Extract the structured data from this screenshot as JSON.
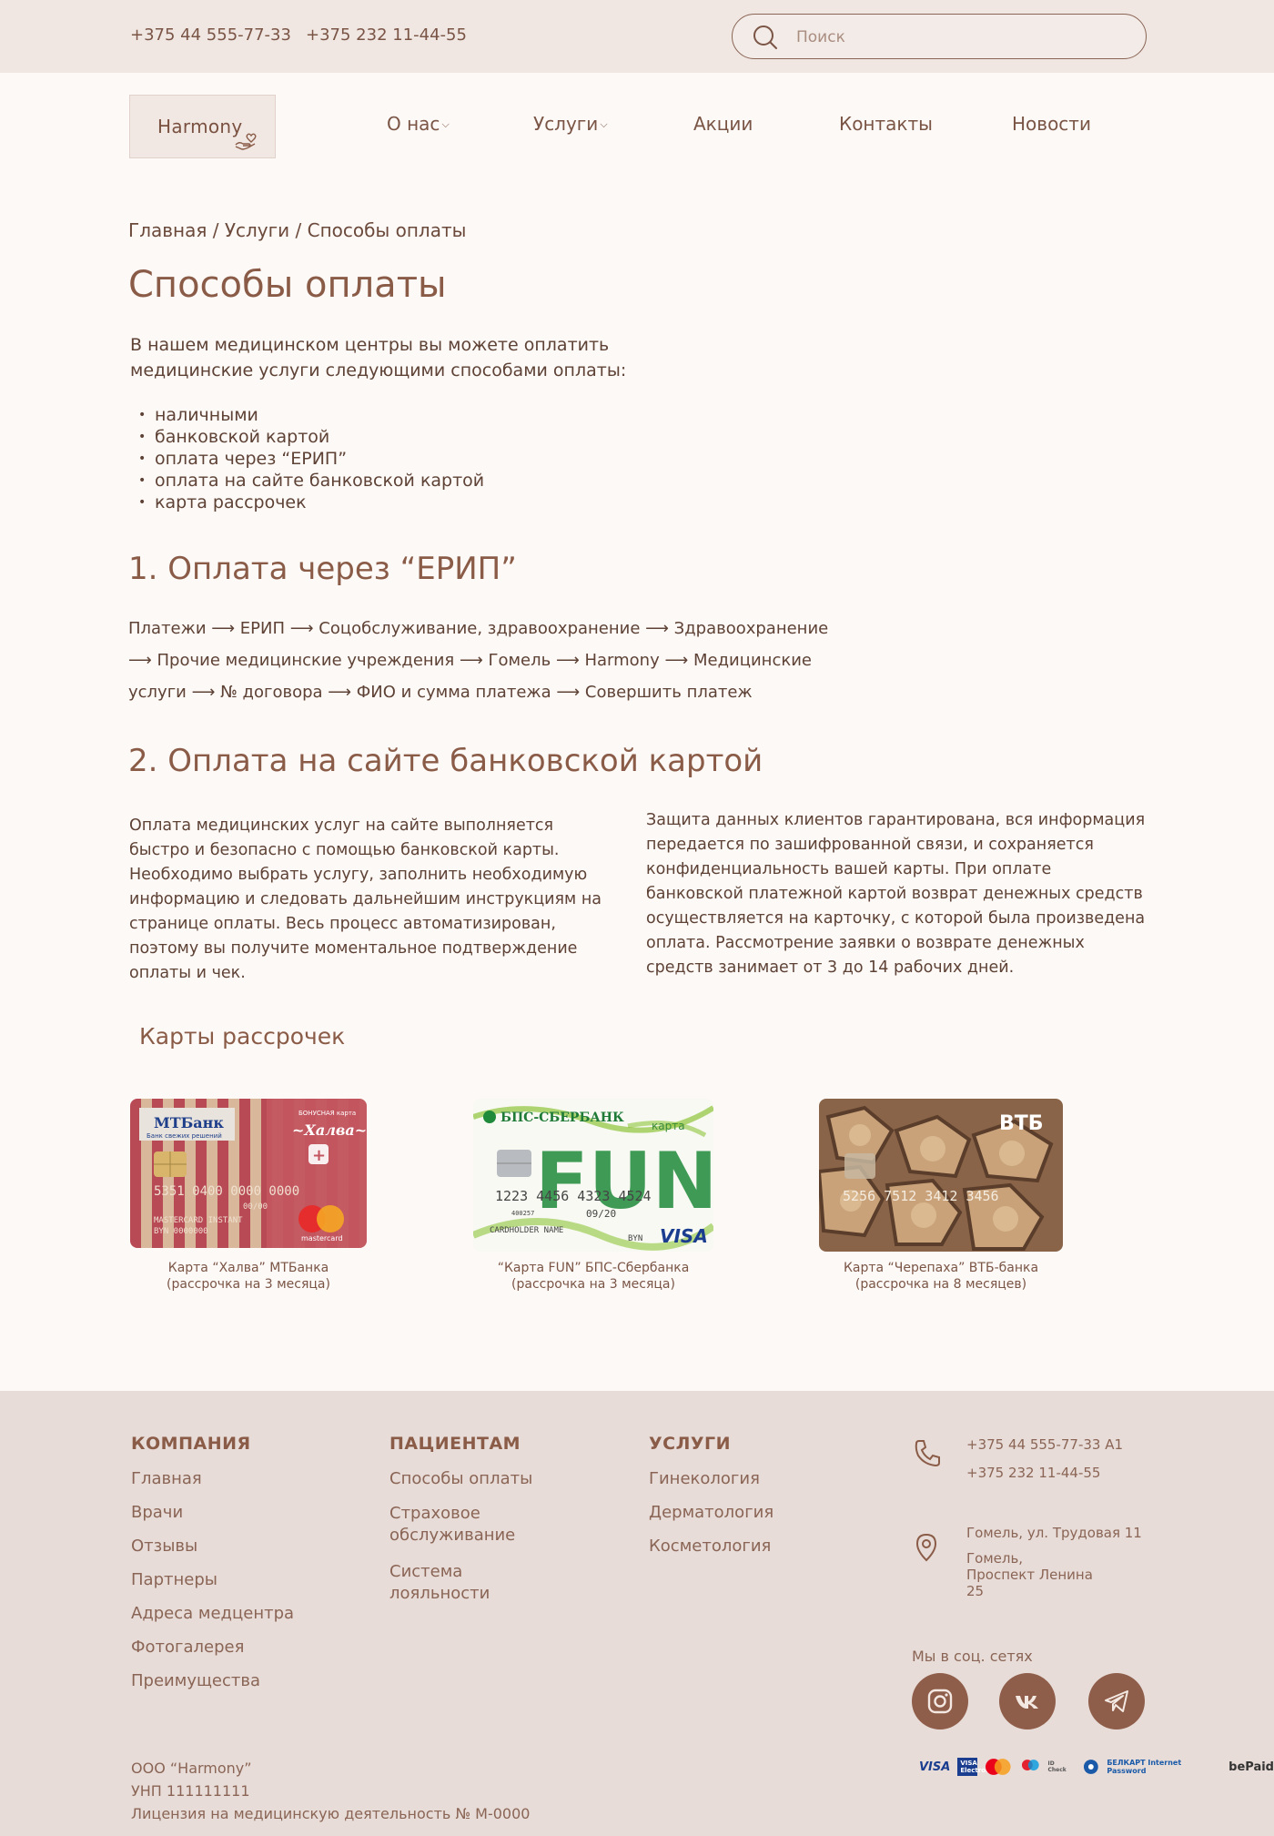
{
  "topbar": {
    "phone1": "+375 44 555-77-33",
    "phone2": "+375 232 11-44-55",
    "search_placeholder": "Поиск"
  },
  "logo": {
    "text": "Harmony"
  },
  "nav": {
    "items": [
      {
        "label": "О нас",
        "dropdown": true
      },
      {
        "label": "Услуги",
        "dropdown": true
      },
      {
        "label": "Акции",
        "dropdown": false
      },
      {
        "label": "Контакты",
        "dropdown": false
      },
      {
        "label": "Новости",
        "dropdown": false
      }
    ]
  },
  "breadcrumb": "Главная / Услуги / Способы оплаты",
  "page_title": "Способы оплаты",
  "intro": "В нашем медицинском центры вы можете оплатить медицинские услуги следующими способами оплаты:",
  "methods": [
    "наличными",
    "банковской картой",
    "оплата через “ЕРИП”",
    "оплата на сайте банковской картой",
    "карта рассрочек"
  ],
  "erip": {
    "title": "1. Оплата через “ЕРИП”",
    "line1": "Платежи ⟶ ЕРИП ⟶ Соцобслуживание, здравоохранение ⟶ Здравоохранение",
    "line2": "⟶ Прочие медицинские учреждения ⟶ Гомель ⟶ Harmony ⟶ Медицинские",
    "line3": "услуги ⟶ № договора ⟶ ФИО и сумма платежа ⟶ Совершить платеж"
  },
  "card_payment": {
    "title": "2. Оплата на сайте банковской картой",
    "left": "Оплата медицинских услуг на сайте выполняется быстро и безопасно с помощью банковской карты. Необходимо выбрать услугу, заполнить необходимую информацию и следовать дальнейшим инструкциям на странице оплаты. Весь процесс автоматизирован, поэтому вы получите моментальное подтверждение оплаты и чек.",
    "right": "Защита данных клиентов гарантирована, вся информация передается по зашифрованной связи, и сохраняется конфиденциальность вашей карты. При оплате банковской платежной картой возврат денежных средств осуществляется на карточку, с которой была произведена оплата. Рассмотрение заявки о возврате денежных средств занимает от 3 до 14 рабочих дней."
  },
  "installments": {
    "title": "Карты рассрочек",
    "cards": [
      {
        "caption1": "Карта “Халва” МТБанка",
        "caption2": "(рассрочка на 3 месяца)",
        "bank": "МТБанк",
        "slogan": "Банк свежих решений",
        "bonus": "БОНУСНАЯ карта",
        "name": "~Халва~",
        "number": "5351 0400 0000 0000",
        "expiry": "00/00",
        "holder1": "MASTERCARD INSTANT",
        "holder2": "BYN 0000000",
        "brand": "mastercard"
      },
      {
        "caption1": "“Карта FUN” БПС-Сбербанка",
        "caption2": "(рассрочка на 3 месяца)",
        "bank": "БПС-СБЕРБАНК",
        "tag": "карта",
        "name": "FUN",
        "number": "1223 4456 4323 4524",
        "code": "400257",
        "expiry": "09/20",
        "holder": "CARDHOLDER NAME",
        "currency": "BYN",
        "brand": "VISA"
      },
      {
        "caption1": "Карта “Черепаха” ВТБ-банка",
        "caption2": "(рассрочка на 8 месяцев)",
        "bank": "ВТБ",
        "number": "5256 7512 3412 3456"
      }
    ]
  },
  "footer": {
    "company": {
      "title": "КОМПАНИЯ",
      "links": [
        "Главная",
        "Врачи",
        "Отзывы",
        "Партнеры",
        "Адреса медцентра",
        "Фотогалерея",
        "Преимущества"
      ]
    },
    "patients": {
      "title": "ПАЦИЕНТАМ",
      "links": [
        "Способы оплаты",
        "Страховое обслуживание",
        "Система лояльности"
      ]
    },
    "services": {
      "title": "УСЛУГИ",
      "links": [
        "Гинекология",
        "Дерматология",
        "Косметология"
      ]
    },
    "contacts": {
      "phone1": "+375 44 555-77-33 A1",
      "phone2": "+375 232 11-44-55",
      "address1": "Гомель, ул. Трудовая 11",
      "address2": "Гомель, Проспект Ленина 25"
    },
    "social_title": "Мы в соц. сетях",
    "legal": {
      "company": "ООО “Harmony”",
      "unp": "УНП 111111111",
      "license": "Лицензия на медицинскую деятельность № М-0000"
    },
    "payments": [
      "VISA",
      "VISA Electron",
      "Mastercard",
      "Maestro",
      "ID Check",
      "БЕЛКАРТ",
      "БЕЛКАРТ Internet Password",
      "bePaid"
    ]
  },
  "colors": {
    "accent": "#8a5c48",
    "topbar": "#f0e6e2",
    "footer": "#e8dcd8",
    "social": "#8f5e4a"
  }
}
